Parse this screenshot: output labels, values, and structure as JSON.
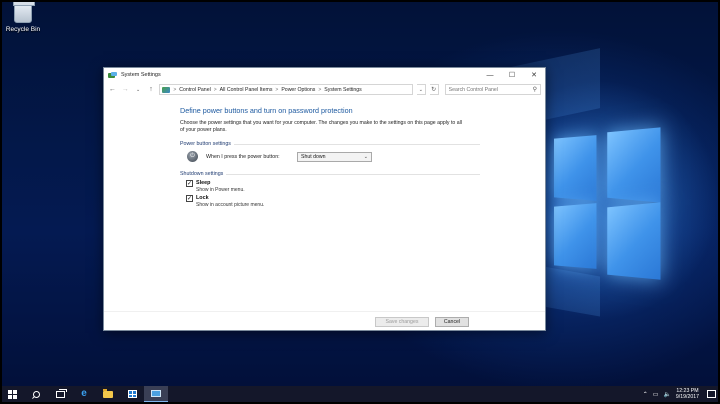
{
  "desktop": {
    "recycle_bin_label": "Recycle Bin"
  },
  "window": {
    "title": "System Settings",
    "controls": {
      "minimize": "—",
      "maximize": "☐",
      "close": "✕"
    },
    "address_bar": {
      "crumbs": [
        "Control Panel",
        "All Control Panel Items",
        "Power Options",
        "System Settings"
      ],
      "separator": ">",
      "search_placeholder": "Search Control Panel"
    },
    "heading": "Define power buttons and turn on password protection",
    "description": "Choose the power settings that you want for your computer. The changes you make to the settings on this page apply to all of your power plans.",
    "power_section": {
      "title": "Power button settings",
      "power_button_label": "When I press the power button:",
      "power_button_value": "Shut down"
    },
    "shutdown_section": {
      "title": "Shutdown settings",
      "items": [
        {
          "label": "Sleep",
          "sub": "Show in Power menu.",
          "checked": true
        },
        {
          "label": "Lock",
          "sub": "Show in account picture menu.",
          "checked": true
        }
      ]
    },
    "footer": {
      "save_label": "Save changes",
      "cancel_label": "Cancel"
    }
  },
  "taskbar": {
    "clock_time": "12:23 PM",
    "clock_date": "9/19/2017"
  },
  "colors": {
    "heading": "#1e5aa0",
    "desktop_bg": "#03184a",
    "taskbar_bg": "#14172a",
    "windows_logo": "#3f93ea"
  }
}
